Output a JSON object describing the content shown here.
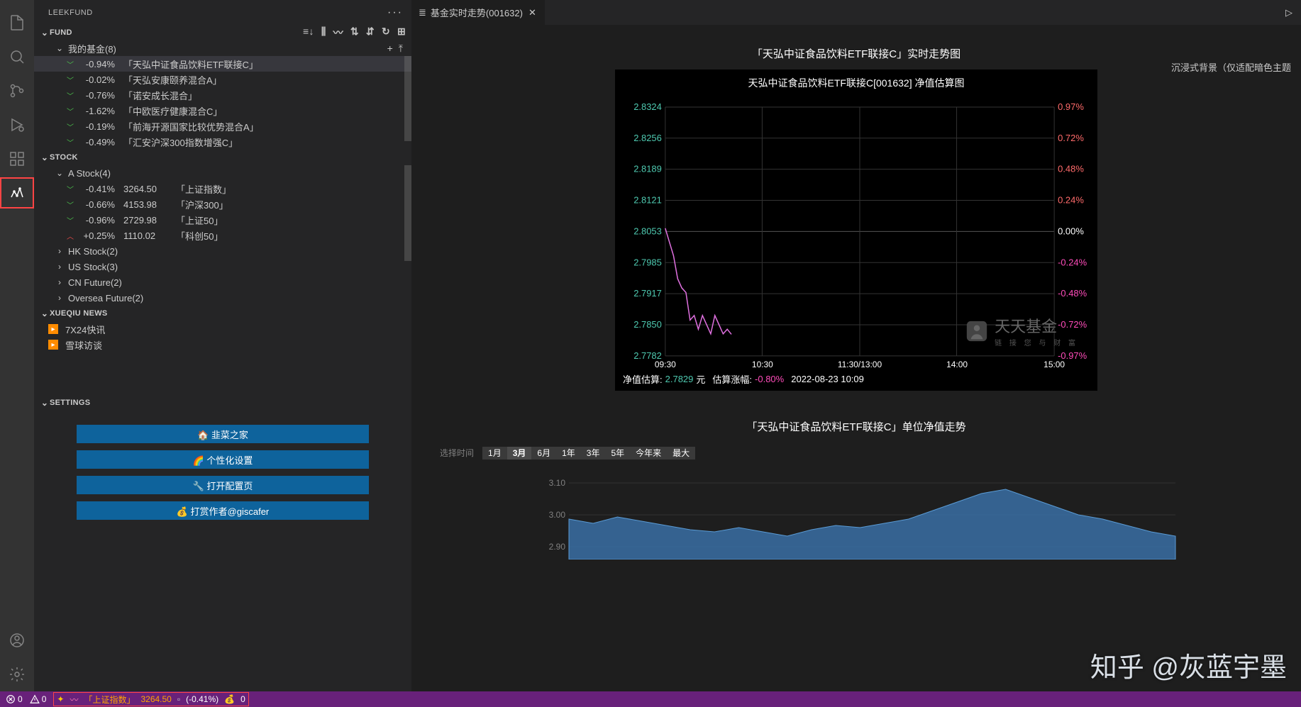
{
  "sidebar_title": "LEEKFUND",
  "fund": {
    "header": "FUND",
    "group_label": "我的基金(8)",
    "items": [
      {
        "pct": "-0.94%",
        "name": "「天弘中证食品饮料ETF联接C」",
        "dir": "down",
        "selected": true
      },
      {
        "pct": "-0.02%",
        "name": "「天弘安康颐养混合A」",
        "dir": "down"
      },
      {
        "pct": "-0.76%",
        "name": "「诺安成长混合」",
        "dir": "down"
      },
      {
        "pct": "-1.62%",
        "name": "「中欧医疗健康混合C」",
        "dir": "down"
      },
      {
        "pct": "-0.19%",
        "name": "「前海开源国家比较优势混合A」",
        "dir": "down"
      },
      {
        "pct": "-0.49%",
        "name": "「汇安沪深300指数增强C」",
        "dir": "down"
      }
    ]
  },
  "stock": {
    "header": "STOCK",
    "a_stock_label": "A Stock(4)",
    "items": [
      {
        "pct": "-0.41%",
        "val": "3264.50",
        "name": "「上证指数」",
        "dir": "down"
      },
      {
        "pct": "-0.66%",
        "val": "4153.98",
        "name": "「沪深300」",
        "dir": "down"
      },
      {
        "pct": "-0.96%",
        "val": "2729.98",
        "name": "「上证50」",
        "dir": "down"
      },
      {
        "pct": "+0.25%",
        "val": "1110.02",
        "name": "「科创50」",
        "dir": "up"
      }
    ],
    "groups": [
      "HK Stock(2)",
      "US Stock(3)",
      "CN Future(2)",
      "Oversea Future(2)"
    ]
  },
  "news": {
    "header": "XUEQIU NEWS",
    "items": [
      "7X24快讯",
      "雪球访谈"
    ]
  },
  "settings": {
    "header": "SETTINGS",
    "buttons": [
      "🏠 韭菜之家",
      "🌈 个性化设置",
      "🔧 打开配置页",
      "💰 打赏作者@giscafer"
    ]
  },
  "tab": {
    "title": "基金实时走势(001632)"
  },
  "editor": {
    "top_right_label": "沉浸式背景（仅适配暗色主题",
    "title1": "「天弘中证食品饮料ETF联接C」实时走势图",
    "subtitle": "天弘中证食品饮料ETF联接C[001632] 净值估算图",
    "footer_label1": "净值估算:",
    "footer_val": "2.7829",
    "footer_unit": "元",
    "footer_label2": "估算涨幅:",
    "footer_pct": "-0.80%",
    "footer_time": "2022-08-23 10:09",
    "title2": "「天弘中证食品饮料ETF联接C」单位净值走势",
    "range_label": "选择时间",
    "ranges": [
      "1月",
      "3月",
      "6月",
      "1年",
      "3年",
      "5年",
      "今年来",
      "最大"
    ],
    "range_active": 1,
    "watermark_big": "天天基金",
    "watermark_small": "链 接 您 与 财 富",
    "zhihu_watermark": "知乎 @灰蓝宇墨"
  },
  "chart_data": {
    "type": "line",
    "title": "天弘中证食品饮料ETF联接C[001632] 净值估算图",
    "y_left_ticks": [
      "2.8324",
      "2.8256",
      "2.8189",
      "2.8121",
      "2.8053",
      "2.7985",
      "2.7917",
      "2.7850",
      "2.7782"
    ],
    "y_right_ticks": [
      "0.97%",
      "0.72%",
      "0.48%",
      "0.24%",
      "0.00%",
      "-0.24%",
      "-0.48%",
      "-0.72%",
      "-0.97%"
    ],
    "x_ticks": [
      "09:30",
      "10:30",
      "11:30/13:00",
      "14:00",
      "15:00"
    ],
    "ylim_left": [
      2.7782,
      2.8324
    ],
    "baseline": 2.8053,
    "series": [
      {
        "name": "净值估算",
        "x": [
          "09:30",
          "09:32",
          "09:35",
          "09:38",
          "09:40",
          "09:43",
          "09:45",
          "09:48",
          "09:50",
          "09:52",
          "09:55",
          "09:58",
          "10:00",
          "10:03",
          "10:05",
          "10:08",
          "10:09"
        ],
        "y": [
          2.806,
          2.803,
          2.8,
          2.795,
          2.793,
          2.792,
          2.786,
          2.787,
          2.784,
          2.787,
          2.785,
          2.783,
          2.787,
          2.785,
          2.783,
          2.784,
          2.7829
        ]
      }
    ]
  },
  "chart_data2": {
    "type": "area",
    "title": "单位净值走势 (3月)",
    "y_ticks": [
      "3.10",
      "3.00",
      "2.90"
    ],
    "ylim": [
      2.85,
      3.15
    ],
    "values": [
      2.98,
      2.96,
      2.99,
      2.97,
      2.95,
      2.93,
      2.92,
      2.94,
      2.92,
      2.9,
      2.93,
      2.95,
      2.94,
      2.96,
      2.98,
      3.02,
      3.06,
      3.1,
      3.12,
      3.08,
      3.04,
      3.0,
      2.98,
      2.95,
      2.92,
      2.9
    ]
  },
  "status": {
    "errors": "0",
    "warnings": "0",
    "stock_name": "「上证指数」",
    "stock_val": "3264.50",
    "stock_pct": "(-0.41%)",
    "coin": "0"
  }
}
